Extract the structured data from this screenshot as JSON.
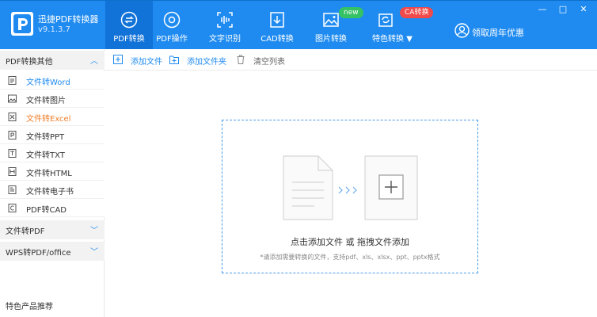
{
  "app": {
    "name": "迅捷PDF转换器",
    "version": "v9.1.3.7"
  },
  "nav": [
    {
      "label": "PDF转换",
      "icon": "convert-arrows-icon",
      "active": true
    },
    {
      "label": "PDF操作",
      "icon": "pdf-operation-icon",
      "active": false
    },
    {
      "label": "文字识别",
      "icon": "text-recognition-icon",
      "active": false
    },
    {
      "label": "CAD转换",
      "icon": "cad-convert-icon",
      "active": false
    },
    {
      "label": "图片转换",
      "icon": "image-convert-icon",
      "active": false,
      "badge": "new"
    },
    {
      "label": "特色转换",
      "icon": "special-convert-icon",
      "active": false,
      "badge": "CA转换",
      "dropdown": true
    }
  ],
  "user": {
    "label": "领取周年优惠"
  },
  "window_controls": {
    "minimize": "—",
    "restore": "□",
    "close": "✕"
  },
  "sidebar": {
    "groups": [
      {
        "label": "PDF转换其他",
        "expanded": true
      },
      {
        "label": "文件转PDF",
        "expanded": false
      },
      {
        "label": "WPS转PDF/office",
        "expanded": false
      }
    ],
    "items": [
      {
        "label": "文件转Word",
        "icon": "word-doc-icon",
        "state": "selected"
      },
      {
        "label": "文件转图片",
        "icon": "image-icon",
        "state": "normal"
      },
      {
        "label": "文件转Excel",
        "icon": "excel-doc-icon",
        "state": "highlight"
      },
      {
        "label": "文件转PPT",
        "icon": "ppt-doc-icon",
        "state": "normal"
      },
      {
        "label": "文件转TXT",
        "icon": "txt-doc-icon",
        "state": "normal"
      },
      {
        "label": "文件转HTML",
        "icon": "html-doc-icon",
        "state": "normal"
      },
      {
        "label": "文件转电子书",
        "icon": "ebook-icon",
        "state": "normal"
      },
      {
        "label": "PDF转CAD",
        "icon": "cad-doc-icon",
        "state": "normal"
      }
    ],
    "footer": "特色产品推荐"
  },
  "toolbar": {
    "add_file": "添加文件",
    "add_folder": "添加文件夹",
    "clear_list": "清空列表"
  },
  "dropzone": {
    "title": "点击添加文件 或 拖拽文件添加",
    "hint": "*请添加需要转换的文件，支持pdf、xls、xlsx、ppt、pptx格式"
  },
  "colors": {
    "header": "#1f8bf0",
    "nav_active": "#1172d8",
    "selected_text": "#1f8bf0",
    "highlight_text": "#f07f2a",
    "badge_new": "#34c264",
    "badge_ca": "#f04a4a"
  }
}
